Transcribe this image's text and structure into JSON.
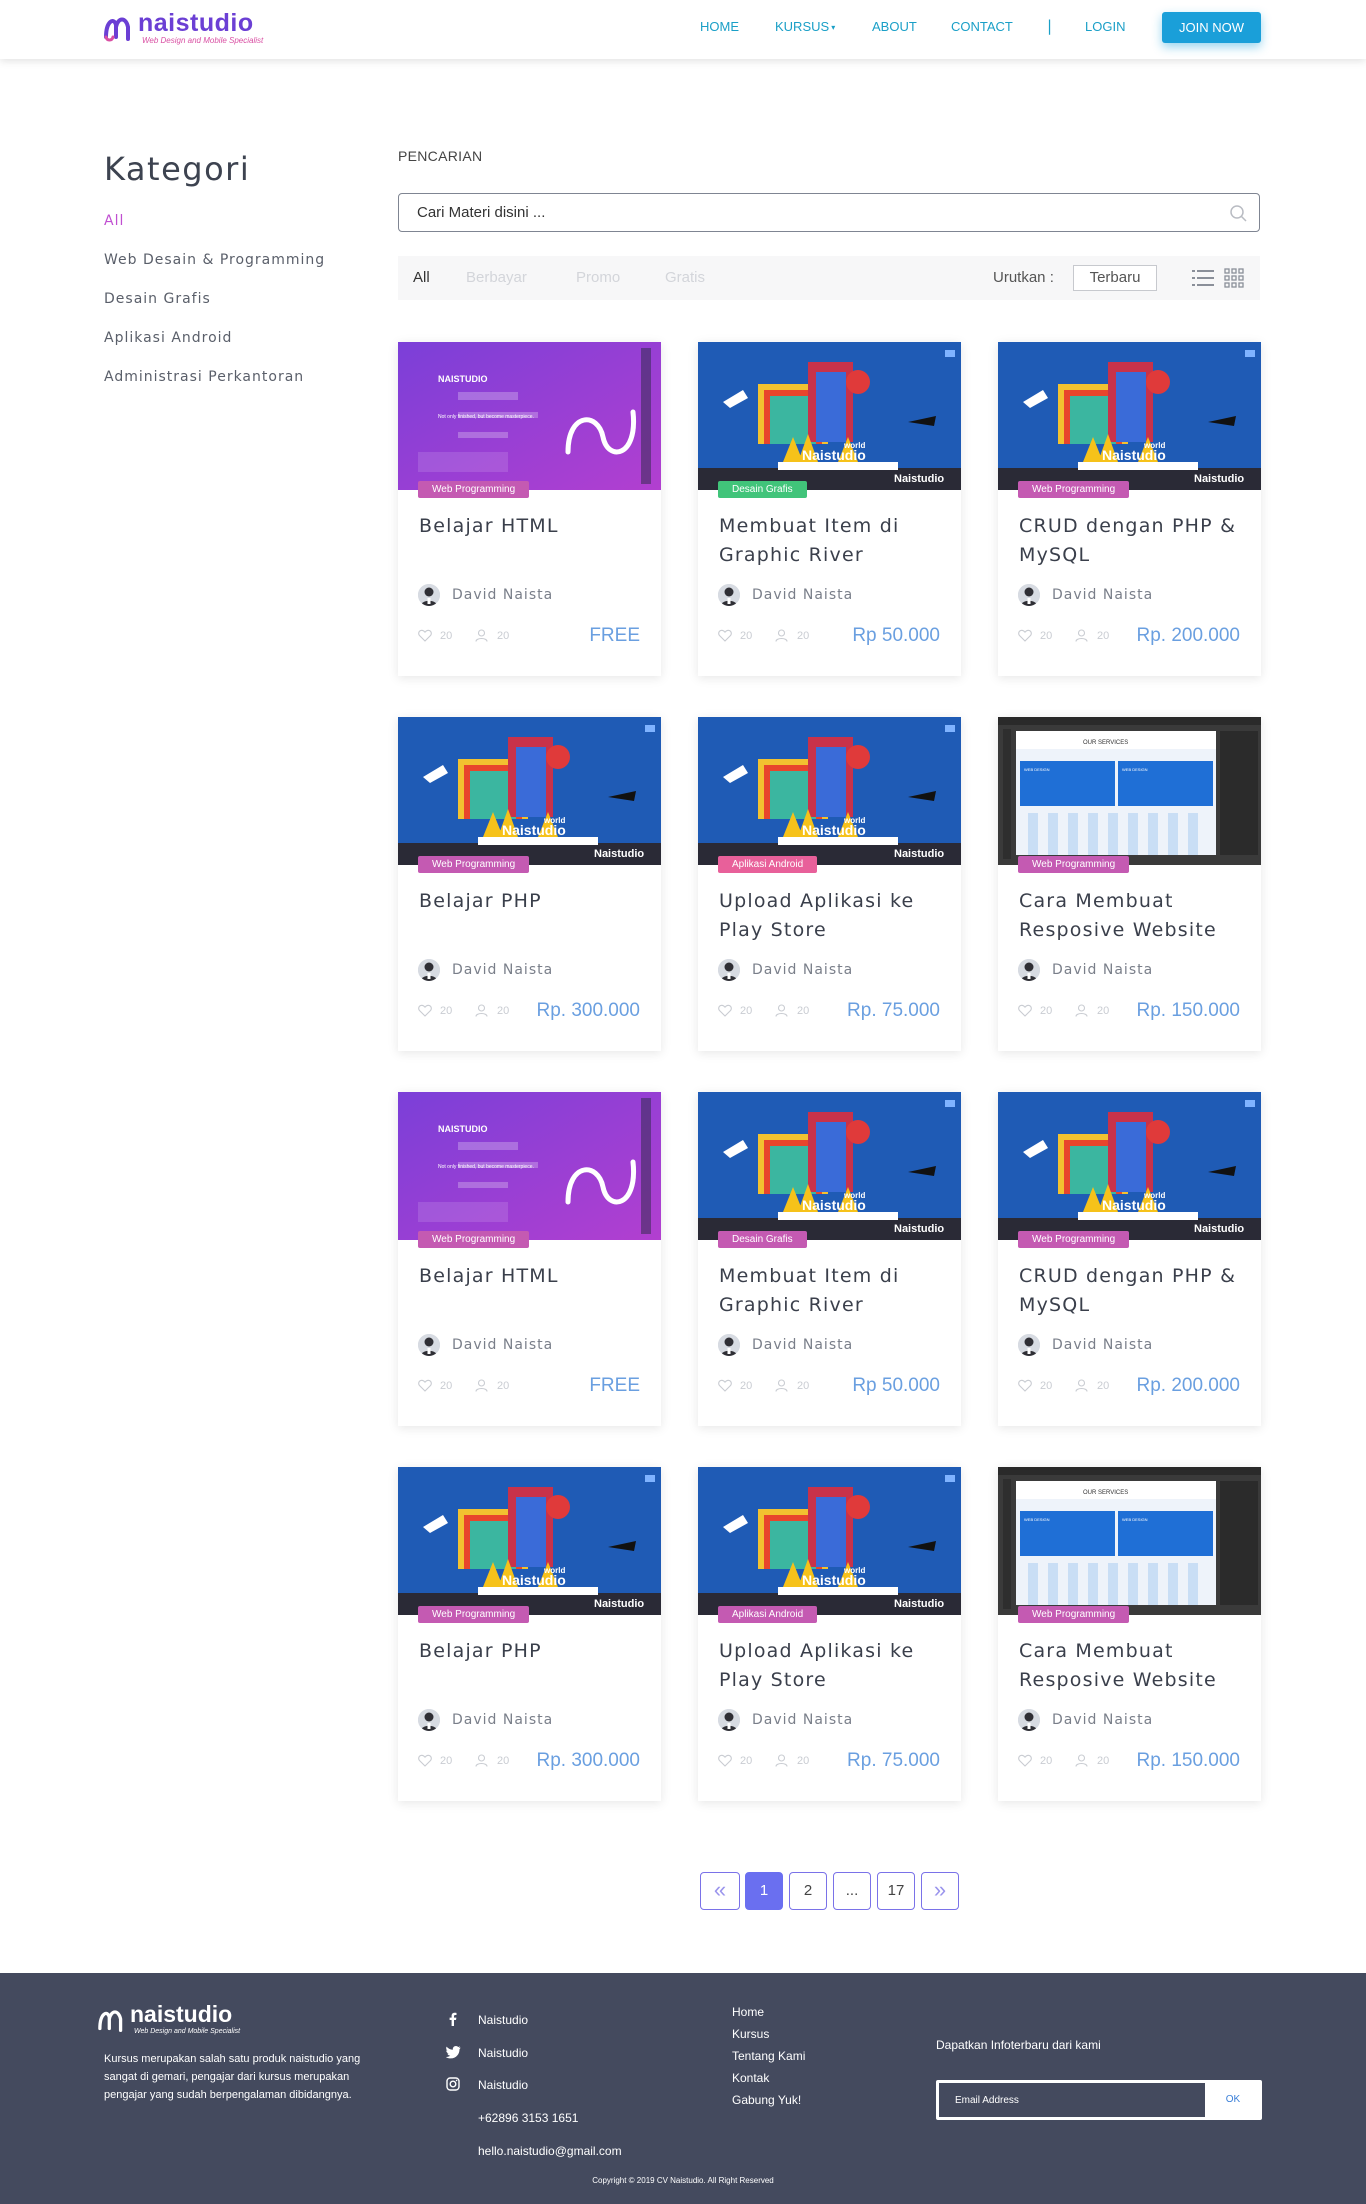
{
  "brand": {
    "name": "naistudio",
    "tagline": "Web Design and Mobile Specialist"
  },
  "nav": {
    "items": [
      "HOME",
      "KURSUS",
      "ABOUT",
      "CONTACT"
    ],
    "separator": "|",
    "login": "LOGIN",
    "join": "JOIN NOW"
  },
  "sidebar": {
    "title": "Kategori",
    "items": [
      "All",
      "Web Desain & Programming",
      "Desain Grafis",
      "Aplikasi Android",
      "Administrasi Perkantoran"
    ],
    "active_index": 0
  },
  "search": {
    "label": "PENCARIAN",
    "placeholder": "Cari Materi disini ..."
  },
  "filters": {
    "tabs": [
      "All",
      "Berbayar",
      "Promo",
      "Gratis"
    ],
    "active_index": 0,
    "sort_label": "Urutkan :",
    "sort_value": "Terbaru"
  },
  "colors": {
    "accent": "#1a9fd9",
    "badge_web": "#c45ab2",
    "badge_desain": "#41c47a",
    "badge_android": "#e8609a",
    "price": "#6a9fe0",
    "pagination": "#6a6ff0",
    "footer_bg": "#444a5e"
  },
  "courses": [
    {
      "title": "Belajar HTML",
      "badge": "Web Programming",
      "badge_color": "#c45ab2",
      "thumb": "html",
      "author": "David Naista",
      "likes": "20",
      "students": "20",
      "price": "FREE"
    },
    {
      "title": "Membuat Item di Graphic River",
      "badge": "Desain Grafis",
      "badge_color": "#41c47a",
      "thumb": "world",
      "author": "David Naista",
      "likes": "20",
      "students": "20",
      "price": "Rp 50.000"
    },
    {
      "title": "CRUD dengan PHP & MySQL",
      "badge": "Web Programming",
      "badge_color": "#c45ab2",
      "thumb": "world",
      "author": "David Naista",
      "likes": "20",
      "students": "20",
      "price": "Rp. 200.000"
    },
    {
      "title": "Belajar PHP",
      "badge": "Web Programming",
      "badge_color": "#c45ab2",
      "thumb": "world",
      "author": "David Naista",
      "likes": "20",
      "students": "20",
      "price": "Rp. 300.000"
    },
    {
      "title": "Upload Aplikasi ke Play Store",
      "badge": "Aplikasi Android",
      "badge_color": "#e8609a",
      "thumb": "world",
      "author": "David Naista",
      "likes": "20",
      "students": "20",
      "price": "Rp. 75.000"
    },
    {
      "title": "Cara Membuat Resposive Website",
      "badge": "Web Programming",
      "badge_color": "#c45ab2",
      "thumb": "ps",
      "author": "David Naista",
      "likes": "20",
      "students": "20",
      "price": "Rp. 150.000"
    },
    {
      "title": "Belajar HTML",
      "badge": "Web Programming",
      "badge_color": "#c45ab2",
      "thumb": "html",
      "author": "David Naista",
      "likes": "20",
      "students": "20",
      "price": "FREE"
    },
    {
      "title": "Membuat Item di Graphic River",
      "badge": "Desain Grafis",
      "badge_color": "#c45ab2",
      "thumb": "world",
      "author": "David Naista",
      "likes": "20",
      "students": "20",
      "price": "Rp 50.000"
    },
    {
      "title": "CRUD dengan PHP & MySQL",
      "badge": "Web Programming",
      "badge_color": "#c45ab2",
      "thumb": "world",
      "author": "David Naista",
      "likes": "20",
      "students": "20",
      "price": "Rp. 200.000"
    },
    {
      "title": "Belajar PHP",
      "badge": "Web Programming",
      "badge_color": "#c45ab2",
      "thumb": "world",
      "author": "David Naista",
      "likes": "20",
      "students": "20",
      "price": "Rp. 300.000"
    },
    {
      "title": "Upload Aplikasi ke Play Store",
      "badge": "Aplikasi Android",
      "badge_color": "#c45ab2",
      "thumb": "world",
      "author": "David Naista",
      "likes": "20",
      "students": "20",
      "price": "Rp. 75.000"
    },
    {
      "title": "Cara Membuat Resposive Website",
      "badge": "Web Programming",
      "badge_color": "#c45ab2",
      "thumb": "ps",
      "author": "David Naista",
      "likes": "20",
      "students": "20",
      "price": "Rp. 150.000"
    }
  ],
  "thumb_text": {
    "html_brand": "NAISTUDIO",
    "html_tagline": "Not only finished, but become masterpiece.",
    "world_small": "world",
    "world_big": "Naistudio",
    "world_corner": "Naistudio",
    "ps_heading": "OUR SERVICES",
    "ps_box": "WEB DESIGN"
  },
  "pagination": {
    "prev": "«",
    "pages": [
      "1",
      "2",
      "...",
      "17"
    ],
    "active": "1",
    "next": "»"
  },
  "footer": {
    "description": "Kursus merupakan salah satu produk naistudio yang sangat di gemari, pengajar dari kursus merupakan pengajar yang sudah berpengalaman dibidangnya.",
    "social": [
      {
        "icon": "facebook-icon",
        "label": "Naistudio"
      },
      {
        "icon": "twitter-icon",
        "label": "Naistudio"
      },
      {
        "icon": "instagram-icon",
        "label": "Naistudio"
      }
    ],
    "phone": "+62896 3153 1651",
    "email": "hello.naistudio@gmail.com",
    "links": [
      "Home",
      "Kursus",
      "Tentang Kami",
      "Kontak",
      "Gabung Yuk!"
    ],
    "newsletter_title": "Dapatkan Infoterbaru dari kami",
    "email_placeholder": "Email Address",
    "ok_label": "OK",
    "copyright": "Copyright © 2019 CV Naistudio. All Right Reserved"
  }
}
